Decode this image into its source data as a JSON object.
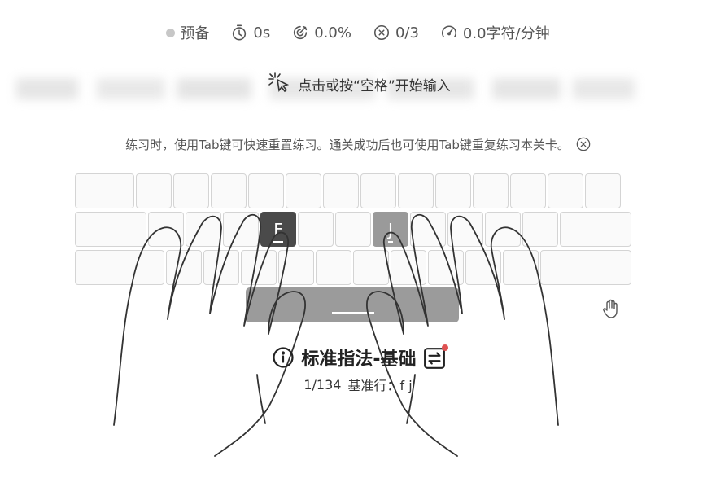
{
  "stats": {
    "status_label": "预备",
    "time": "0s",
    "accuracy": "0.0%",
    "errors": "0/3",
    "speed": "0.0字符/分钟"
  },
  "start_hint": "点击或按“空格”开始输入",
  "tip": "练习时，使用Tab键可快速重置练习。通关成功后也可使用Tab键重复练习本关卡。",
  "keyboard": {
    "highlight_left": "F",
    "highlight_right": "J"
  },
  "lesson": {
    "title": "标准指法-基础",
    "progress": "1/134",
    "row_label": "基准行：",
    "keys": "f j"
  },
  "icons": {
    "status": "dot-icon",
    "time": "timer-icon",
    "accuracy": "accuracy-icon",
    "errors": "error-circle-icon",
    "speed": "speedometer-icon",
    "start": "click-pointer-icon",
    "close_tip": "close-icon",
    "hand": "hand-icon",
    "info": "info-icon",
    "switch": "switch-icon"
  },
  "colors": {
    "key_f": "#4a4a4a",
    "key_j": "#9a9a9a",
    "spacebar": "#9b9b9b",
    "notify_dot": "#e05252"
  }
}
